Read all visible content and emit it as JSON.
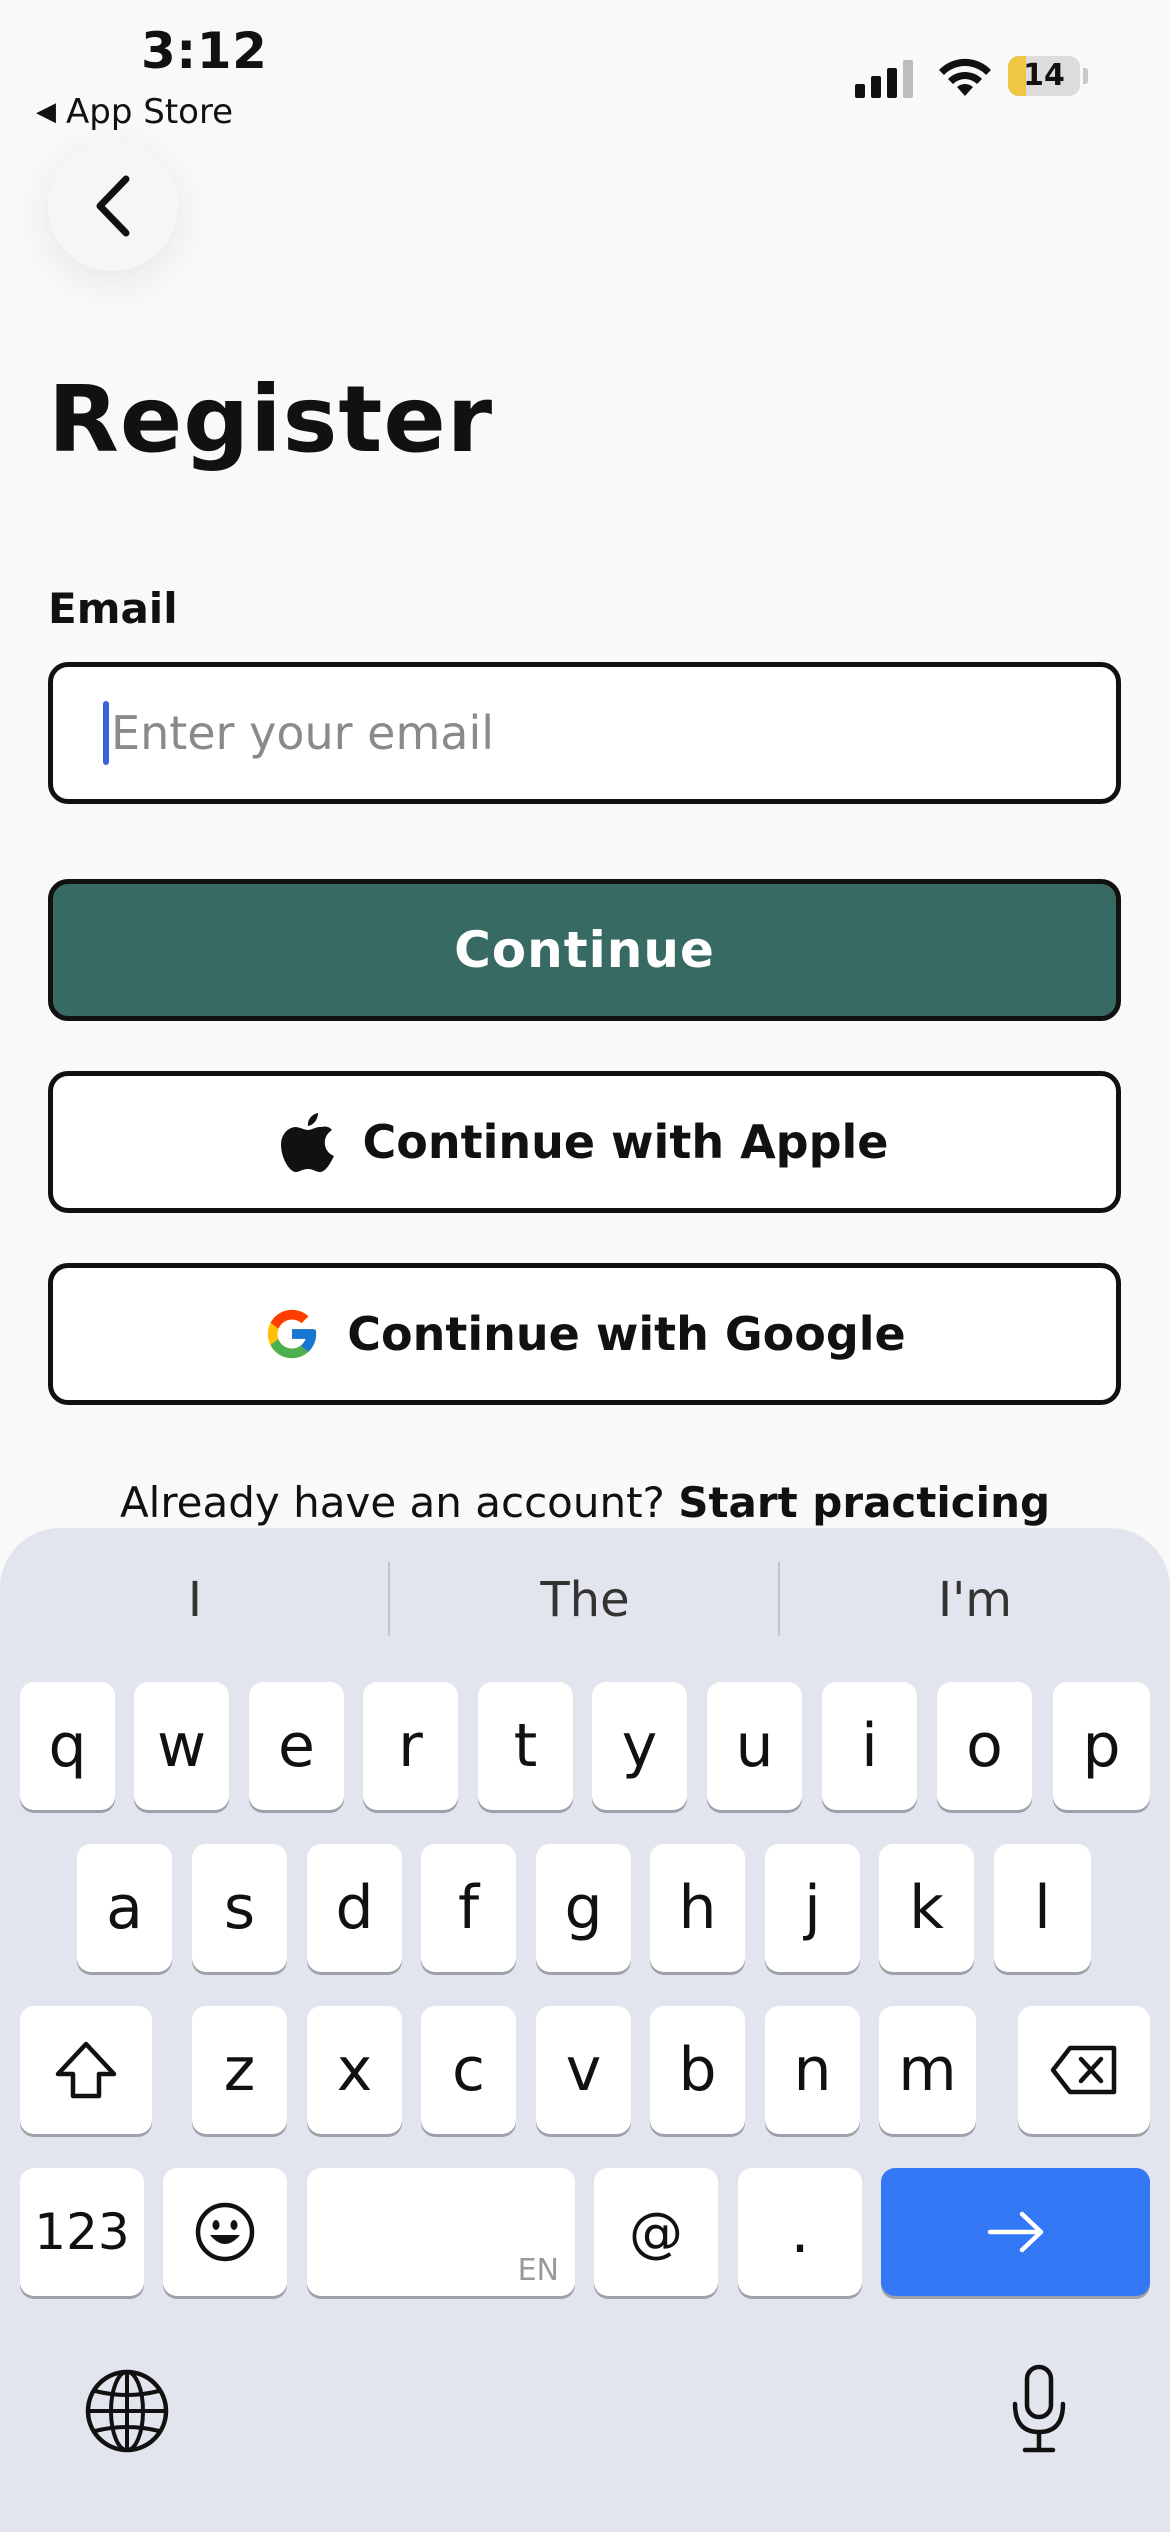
{
  "status_bar": {
    "time": "3:12",
    "back_app_label": "App Store",
    "battery_level": "14",
    "battery_fraction": 0.14,
    "battery_color": "#f0c645"
  },
  "header": {
    "back_icon": "chevron-left-icon",
    "title": "Register"
  },
  "form": {
    "email_label": "Email",
    "email_value": "",
    "email_placeholder": "Enter your email",
    "continue_label": "Continue",
    "apple_label": "Continue with Apple",
    "apple_icon": "apple-icon",
    "google_label": "Continue with Google",
    "google_icon": "google-icon"
  },
  "footer": {
    "prompt": "Already have an account?",
    "link": "Start practicing"
  },
  "keyboard": {
    "suggestions": [
      "I",
      "The",
      "I'm"
    ],
    "row1": [
      "q",
      "w",
      "e",
      "r",
      "t",
      "y",
      "u",
      "i",
      "o",
      "p"
    ],
    "row2": [
      "a",
      "s",
      "d",
      "f",
      "g",
      "h",
      "j",
      "k",
      "l"
    ],
    "row3": [
      "z",
      "x",
      "c",
      "v",
      "b",
      "n",
      "m"
    ],
    "numbers_key": "123",
    "space_lang": "EN",
    "at_key": "@",
    "dot_key": ".",
    "shift_icon": "shift-icon",
    "delete_icon": "backspace-icon",
    "emoji_icon": "emoji-icon",
    "return_icon": "arrow-right-icon",
    "globe_icon": "globe-icon",
    "mic_icon": "microphone-icon",
    "accent_color": "#3478f6"
  },
  "colors": {
    "primary_button": "#366a62",
    "background": "#f9f9f9",
    "keyboard_bg": "#e3e5ee"
  }
}
